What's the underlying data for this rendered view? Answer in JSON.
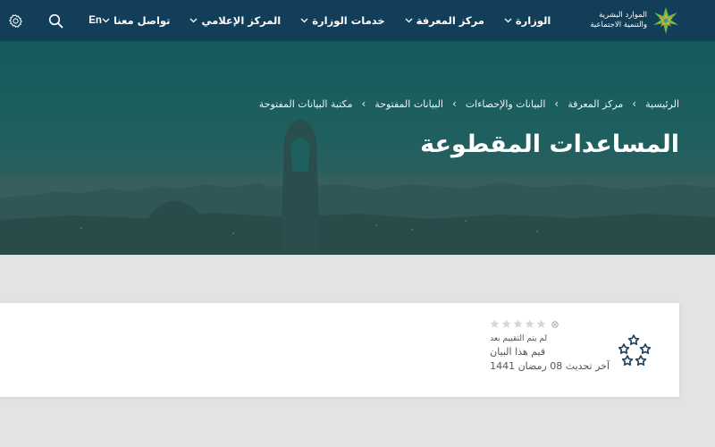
{
  "brand": {
    "line1": "الموارد البشرية",
    "line2": "والتنمية الاجتماعية"
  },
  "nav": {
    "items": [
      {
        "label": "الوزارة"
      },
      {
        "label": "مركز المعرفة"
      },
      {
        "label": "خدمات الوزارة"
      },
      {
        "label": "المركز الإعلامي"
      },
      {
        "label": "تواصل معنا"
      }
    ],
    "language": "En",
    "icons": [
      "search-icon",
      "gear-icon"
    ]
  },
  "breadcrumb": [
    {
      "label": "الرئيسية"
    },
    {
      "label": "مركز المعرفة"
    },
    {
      "label": "البيانات والإحصاءات"
    },
    {
      "label": "البيانات المفتوحة"
    },
    {
      "label": "مكتبة البيانات المفتوحة"
    }
  ],
  "page": {
    "title": "المساعدات المقطوعة"
  },
  "dataset": {
    "rating": {
      "stars_filled": 0,
      "stars_total": 5,
      "not_rated_text": "لم يتم التقييم بعد",
      "rate_link_text": "قيم هذا البيان"
    },
    "updated_text": "آخر تحديث 08 رمضان 1441"
  },
  "colors": {
    "navbar": "#133e5a",
    "hero": "#1f5f5f",
    "brand_green": "#6cbf4a",
    "brand_orange": "#f4a21f",
    "star_empty": "#d6d6d6",
    "stars_logo": "#1b3f5c"
  }
}
